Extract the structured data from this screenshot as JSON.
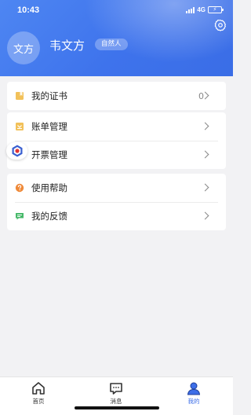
{
  "status_bar": {
    "time": "10:43",
    "network": "4G",
    "battery_glyph": "⚡"
  },
  "profile": {
    "avatar_text": "文方",
    "name": "韦文方",
    "badge": "自然人"
  },
  "menu_groups": [
    {
      "items": [
        {
          "label": "我的证书",
          "count": "0",
          "icon": "certificate-icon"
        }
      ]
    },
    {
      "items": [
        {
          "label": "账单管理",
          "icon": "bill-icon"
        },
        {
          "label": "开票管理",
          "icon": "invoice-icon"
        }
      ]
    },
    {
      "items": [
        {
          "label": "使用帮助",
          "icon": "help-icon"
        },
        {
          "label": "我的反馈",
          "icon": "feedback-icon"
        }
      ]
    }
  ],
  "tabs": [
    {
      "label": "首页",
      "icon": "home-icon",
      "active": false
    },
    {
      "label": "消息",
      "icon": "message-icon",
      "active": false
    },
    {
      "label": "我的",
      "icon": "profile-icon",
      "active": true
    }
  ],
  "colors": {
    "accent": "#3d6ee8",
    "header": "#4e86f2",
    "background": "#f2f2f4"
  }
}
